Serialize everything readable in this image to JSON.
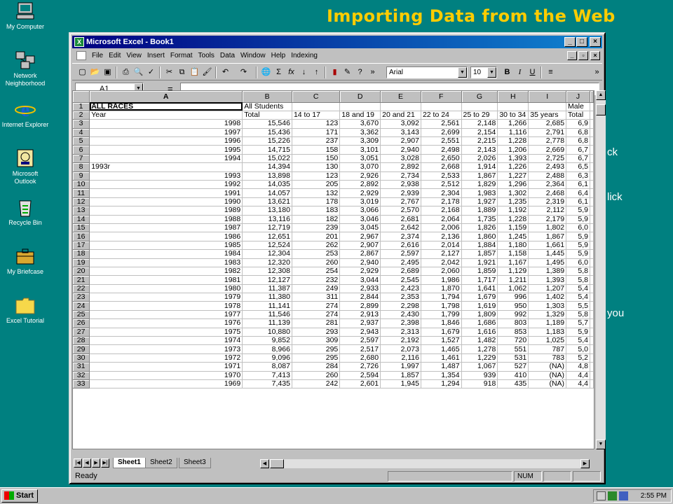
{
  "desktop": {
    "icons": [
      {
        "label": "My Computer",
        "icon": "my-computer-icon"
      },
      {
        "label": "Network Neighborhood",
        "icon": "network-neighborhood-icon"
      },
      {
        "label": "Internet Explorer",
        "icon": "internet-explorer-icon"
      },
      {
        "label": "Microsoft Outlook",
        "icon": "outlook-icon"
      },
      {
        "label": "Recycle Bin",
        "icon": "recycle-bin-icon"
      },
      {
        "label": "My Briefcase",
        "icon": "briefcase-icon"
      },
      {
        "label": "Excel Tutorial",
        "icon": "folder-icon"
      }
    ]
  },
  "slide": {
    "title": "Importing Data from the Web",
    "fragments": [
      "ck",
      "lick",
      "you"
    ]
  },
  "window": {
    "title": "Microsoft Excel - Book1",
    "menu": [
      "File",
      "Edit",
      "View",
      "Insert",
      "Format",
      "Tools",
      "Data",
      "Window",
      "Help",
      "Indexing"
    ],
    "font_name": "Arial",
    "font_size": "10",
    "bold": "B",
    "italic": "I",
    "underline": "U",
    "name_box": "A1",
    "formula_eq": "="
  },
  "sheet": {
    "columns": [
      "A",
      "B",
      "C",
      "D",
      "E",
      "F",
      "G",
      "H",
      "I",
      "J"
    ],
    "rows": [
      [
        "ALL RACES",
        "All Students",
        "",
        "",
        "",
        "",
        "",
        "",
        "",
        "Male"
      ],
      [
        "Year",
        "Total",
        "14 to 17",
        "18 and 19",
        "20 and 21",
        "22 to 24",
        "25 to 29",
        "30 to 34",
        "35 years",
        "Total"
      ],
      [
        "1998",
        "15,546",
        "123",
        "3,670",
        "3,092",
        "2,561",
        "2,148",
        "1,266",
        "2,685",
        "6,9"
      ],
      [
        "1997",
        "15,436",
        "171",
        "3,362",
        "3,143",
        "2,699",
        "2,154",
        "1,116",
        "2,791",
        "6,8"
      ],
      [
        "1996",
        "15,226",
        "237",
        "3,309",
        "2,907",
        "2,551",
        "2,215",
        "1,228",
        "2,778",
        "6,8"
      ],
      [
        "1995",
        "14,715",
        "158",
        "3,101",
        "2,940",
        "2,498",
        "2,143",
        "1,206",
        "2,669",
        "6,7"
      ],
      [
        "1994",
        "15,022",
        "150",
        "3,051",
        "3,028",
        "2,650",
        "2,026",
        "1,393",
        "2,725",
        "6,7"
      ],
      [
        "1993r",
        "14,394",
        "130",
        "3,070",
        "2,892",
        "2,668",
        "1,914",
        "1,226",
        "2,493",
        "6,5"
      ],
      [
        "1993",
        "13,898",
        "123",
        "2,926",
        "2,734",
        "2,533",
        "1,867",
        "1,227",
        "2,488",
        "6,3"
      ],
      [
        "1992",
        "14,035",
        "205",
        "2,892",
        "2,938",
        "2,512",
        "1,829",
        "1,296",
        "2,364",
        "6,1"
      ],
      [
        "1991",
        "14,057",
        "132",
        "2,929",
        "2,939",
        "2,304",
        "1,983",
        "1,302",
        "2,468",
        "6,4"
      ],
      [
        "1990",
        "13,621",
        "178",
        "3,019",
        "2,767",
        "2,178",
        "1,927",
        "1,235",
        "2,319",
        "6,1"
      ],
      [
        "1989",
        "13,180",
        "183",
        "3,066",
        "2,570",
        "2,168",
        "1,889",
        "1,192",
        "2,112",
        "5,9"
      ],
      [
        "1988",
        "13,116",
        "182",
        "3,046",
        "2,681",
        "2,064",
        "1,735",
        "1,228",
        "2,179",
        "5,9"
      ],
      [
        "1987",
        "12,719",
        "239",
        "3,045",
        "2,642",
        "2,006",
        "1,826",
        "1,159",
        "1,802",
        "6,0"
      ],
      [
        "1986",
        "12,651",
        "201",
        "2,967",
        "2,374",
        "2,136",
        "1,860",
        "1,245",
        "1,867",
        "5,9"
      ],
      [
        "1985",
        "12,524",
        "262",
        "2,907",
        "2,616",
        "2,014",
        "1,884",
        "1,180",
        "1,661",
        "5,9"
      ],
      [
        "1984",
        "12,304",
        "253",
        "2,867",
        "2,597",
        "2,127",
        "1,857",
        "1,158",
        "1,445",
        "5,9"
      ],
      [
        "1983",
        "12,320",
        "260",
        "2,940",
        "2,495",
        "2,042",
        "1,921",
        "1,167",
        "1,495",
        "6,0"
      ],
      [
        "1982",
        "12,308",
        "254",
        "2,929",
        "2,689",
        "2,060",
        "1,859",
        "1,129",
        "1,389",
        "5,8"
      ],
      [
        "1981",
        "12,127",
        "232",
        "3,044",
        "2,545",
        "1,986",
        "1,717",
        "1,211",
        "1,393",
        "5,8"
      ],
      [
        "1980",
        "11,387",
        "249",
        "2,933",
        "2,423",
        "1,870",
        "1,641",
        "1,062",
        "1,207",
        "5,4"
      ],
      [
        "1979",
        "11,380",
        "311",
        "2,844",
        "2,353",
        "1,794",
        "1,679",
        "996",
        "1,402",
        "5,4"
      ],
      [
        "1978",
        "11,141",
        "274",
        "2,899",
        "2,298",
        "1,798",
        "1,619",
        "950",
        "1,303",
        "5,5"
      ],
      [
        "1977",
        "11,546",
        "274",
        "2,913",
        "2,430",
        "1,799",
        "1,809",
        "992",
        "1,329",
        "5,8"
      ],
      [
        "1976",
        "11,139",
        "281",
        "2,937",
        "2,398",
        "1,846",
        "1,686",
        "803",
        "1,189",
        "5,7"
      ],
      [
        "1975",
        "10,880",
        "293",
        "2,943",
        "2,313",
        "1,679",
        "1,616",
        "853",
        "1,183",
        "5,9"
      ],
      [
        "1974",
        "9,852",
        "309",
        "2,597",
        "2,192",
        "1,527",
        "1,482",
        "720",
        "1,025",
        "5,4"
      ],
      [
        "1973",
        "8,966",
        "295",
        "2,517",
        "2,073",
        "1,465",
        "1,278",
        "551",
        "787",
        "5,0"
      ],
      [
        "1972",
        "9,096",
        "295",
        "2,680",
        "2,116",
        "1,461",
        "1,229",
        "531",
        "783",
        "5,2"
      ],
      [
        "1971",
        "8,087",
        "284",
        "2,726",
        "1,997",
        "1,487",
        "1,067",
        "527",
        "(NA)",
        "4,8"
      ],
      [
        "1970",
        "7,413",
        "260",
        "2,594",
        "1,857",
        "1,354",
        "939",
        "410",
        "(NA)",
        "4,4"
      ],
      [
        "1969",
        "7,435",
        "242",
        "2,601",
        "1,945",
        "1,294",
        "918",
        "435",
        "(NA)",
        "4,4"
      ]
    ],
    "tabs": [
      "Sheet1",
      "Sheet2",
      "Sheet3"
    ],
    "status": "Ready",
    "num_indicator": "NUM"
  },
  "taskbar": {
    "start_label": "Start",
    "clock": "2:55 PM"
  }
}
